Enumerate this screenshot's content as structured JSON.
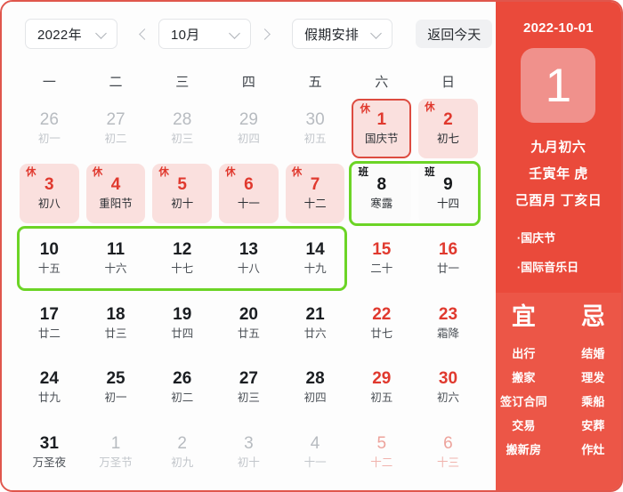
{
  "toolbar": {
    "year_select": "2022年",
    "month_select": "10月",
    "filter_select": "假期安排",
    "today_button": "返回今天",
    "prev_icon": "chevron-left-icon",
    "next_icon": "chevron-right-icon"
  },
  "weekdays": [
    "一",
    "二",
    "三",
    "四",
    "五",
    "六",
    "日"
  ],
  "grid": [
    [
      {
        "num": "26",
        "sub": "初一",
        "muted": true
      },
      {
        "num": "27",
        "sub": "初二",
        "muted": true
      },
      {
        "num": "28",
        "sub": "初三",
        "muted": true
      },
      {
        "num": "29",
        "sub": "初四",
        "muted": true
      },
      {
        "num": "30",
        "sub": "初五",
        "muted": true
      },
      {
        "num": "1",
        "sub": "国庆节",
        "badge": "休",
        "holiday": true,
        "selected": true
      },
      {
        "num": "2",
        "sub": "初七",
        "badge": "休",
        "holiday": true
      }
    ],
    [
      {
        "num": "3",
        "sub": "初八",
        "badge": "休",
        "holiday": true
      },
      {
        "num": "4",
        "sub": "重阳节",
        "badge": "休",
        "holiday": true
      },
      {
        "num": "5",
        "sub": "初十",
        "badge": "休",
        "holiday": true
      },
      {
        "num": "6",
        "sub": "十一",
        "badge": "休",
        "holiday": true
      },
      {
        "num": "7",
        "sub": "十二",
        "badge": "休",
        "holiday": true
      },
      {
        "num": "8",
        "sub": "寒露",
        "badge": "班",
        "work": true
      },
      {
        "num": "9",
        "sub": "十四",
        "badge": "班",
        "work": true
      }
    ],
    [
      {
        "num": "10",
        "sub": "十五"
      },
      {
        "num": "11",
        "sub": "十六"
      },
      {
        "num": "12",
        "sub": "十七"
      },
      {
        "num": "13",
        "sub": "十八"
      },
      {
        "num": "14",
        "sub": "十九"
      },
      {
        "num": "15",
        "sub": "二十",
        "weekend": true
      },
      {
        "num": "16",
        "sub": "廿一",
        "weekend": true
      }
    ],
    [
      {
        "num": "17",
        "sub": "廿二"
      },
      {
        "num": "18",
        "sub": "廿三"
      },
      {
        "num": "19",
        "sub": "廿四"
      },
      {
        "num": "20",
        "sub": "廿五"
      },
      {
        "num": "21",
        "sub": "廿六"
      },
      {
        "num": "22",
        "sub": "廿七",
        "weekend": true
      },
      {
        "num": "23",
        "sub": "霜降",
        "weekend": true
      }
    ],
    [
      {
        "num": "24",
        "sub": "廿九"
      },
      {
        "num": "25",
        "sub": "初一"
      },
      {
        "num": "26",
        "sub": "初二"
      },
      {
        "num": "27",
        "sub": "初三"
      },
      {
        "num": "28",
        "sub": "初四"
      },
      {
        "num": "29",
        "sub": "初五",
        "weekend": true
      },
      {
        "num": "30",
        "sub": "初六",
        "weekend": true
      }
    ],
    [
      {
        "num": "31",
        "sub": "万圣夜"
      },
      {
        "num": "1",
        "sub": "万圣节",
        "muted": true
      },
      {
        "num": "2",
        "sub": "初九",
        "muted": true
      },
      {
        "num": "3",
        "sub": "初十",
        "muted": true
      },
      {
        "num": "4",
        "sub": "十一",
        "muted": true
      },
      {
        "num": "5",
        "sub": "十二",
        "muted": true,
        "weekend": true
      },
      {
        "num": "6",
        "sub": "十三",
        "muted": true,
        "weekend": true
      }
    ]
  ],
  "detail": {
    "date": "2022-10-01",
    "day_number": "1",
    "lunar_day": "九月初六",
    "ganzhi_year": "壬寅年 虎",
    "ganzhi_month_day": "己酉月 丁亥日",
    "festivals": [
      "·国庆节",
      "·国际音乐日"
    ],
    "yi_head": "宜",
    "ji_head": "忌",
    "yi_items": [
      "出行",
      "搬家",
      "签订合同",
      "交易",
      "搬新房"
    ],
    "ji_items": [
      "结婚",
      "理发",
      "乘船",
      "安葬",
      "作灶"
    ]
  },
  "colors": {
    "brand_red": "#ea4a3b",
    "accent_red": "#e0392e",
    "holiday_pink": "#fae0de",
    "highlight_green": "#6cd426",
    "yiji_bg": "#ec5647",
    "big_day_box": "#f0918c"
  }
}
